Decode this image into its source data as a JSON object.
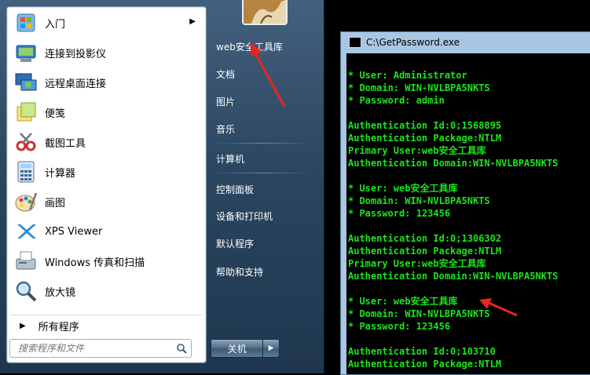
{
  "start_menu": {
    "programs": [
      {
        "label": "入门",
        "icon": "getting-started-icon",
        "has_submenu": true
      },
      {
        "label": "连接到投影仪",
        "icon": "projector-icon",
        "has_submenu": false
      },
      {
        "label": "远程桌面连接",
        "icon": "remote-desktop-icon",
        "has_submenu": false
      },
      {
        "label": "便笺",
        "icon": "sticky-notes-icon",
        "has_submenu": false
      },
      {
        "label": "截图工具",
        "icon": "snipping-tool-icon",
        "has_submenu": false
      },
      {
        "label": "计算器",
        "icon": "calculator-icon",
        "has_submenu": false
      },
      {
        "label": "画图",
        "icon": "paint-icon",
        "has_submenu": false
      },
      {
        "label": "XPS Viewer",
        "icon": "xps-viewer-icon",
        "has_submenu": false
      },
      {
        "label": "Windows 传真和扫描",
        "icon": "fax-scan-icon",
        "has_submenu": false
      },
      {
        "label": "放大镜",
        "icon": "magnifier-icon",
        "has_submenu": false
      }
    ],
    "all_programs": "所有程序",
    "search": {
      "placeholder": "搜索程序和文件"
    },
    "right_items": [
      {
        "label": "web安全工具库"
      },
      {
        "label": "文档"
      },
      {
        "label": "图片"
      },
      {
        "label": "音乐"
      },
      {
        "label": "计算机"
      },
      {
        "label": "控制面板"
      },
      {
        "label": "设备和打印机"
      },
      {
        "label": "默认程序"
      },
      {
        "label": "帮助和支持"
      }
    ],
    "shutdown_label": "关机"
  },
  "console": {
    "title": "C:\\GetPassword.exe",
    "lines": [
      "* User: Administrator",
      "* Domain: WIN-NVLBPA5NKTS",
      "* Password: admin",
      "",
      "Authentication Id:0;1568895",
      "Authentication Package:NTLM",
      "Primary User:web安全工具库",
      "Authentication Domain:WIN-NVLBPA5NKTS",
      "",
      "* User: web安全工具库",
      "* Domain: WIN-NVLBPA5NKTS",
      "* Password: 123456",
      "",
      "Authentication Id:0;1306302",
      "Authentication Package:NTLM",
      "Primary User:web安全工具库",
      "Authentication Domain:WIN-NVLBPA5NKTS",
      "",
      "* User: web安全工具库",
      "* Domain: WIN-NVLBPA5NKTS",
      "* Password: 123456",
      "",
      "Authentication Id:0;103710",
      "Authentication Package:NTLM"
    ],
    "text_color": "#19e619"
  },
  "annotations": {
    "arrow_color": "#e8261f"
  }
}
